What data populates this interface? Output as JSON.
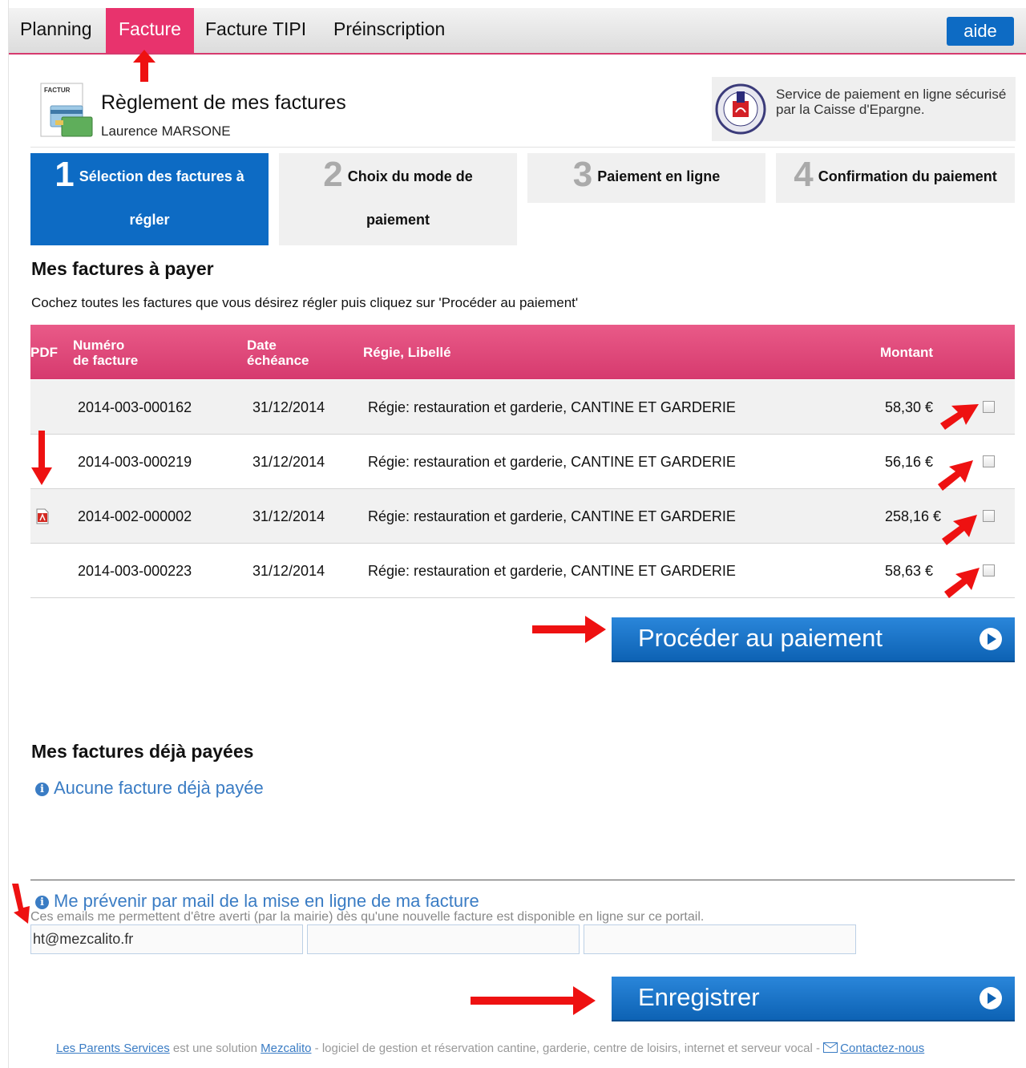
{
  "nav": {
    "tabs": [
      "Planning",
      "Facture",
      "Facture TIPI",
      "Préinscription"
    ],
    "active": "Facture",
    "help_label": "aide"
  },
  "header": {
    "icon_text": "FACTUR",
    "title": "Règlement de mes factures",
    "user": "Laurence MARSONE",
    "secure_text": "Service de paiement en ligne sécurisé par la Caisse d'Epargne."
  },
  "steps": [
    {
      "num": "1",
      "line1": "Sélection des factures à",
      "line2": "régler"
    },
    {
      "num": "2",
      "line1": "Choix du mode de",
      "line2": "paiement"
    },
    {
      "num": "3",
      "line1": "Paiement en ligne",
      "line2": ""
    },
    {
      "num": "4",
      "line1": "Confirmation du paiement",
      "line2": ""
    }
  ],
  "to_pay": {
    "title": "Mes factures à payer",
    "instructions": "Cochez toutes les factures que vous désirez régler puis cliquez sur 'Procéder au paiement'",
    "columns": {
      "pdf": "PDF",
      "number_l1": "Numéro",
      "number_l2": "de facture",
      "date_l1": "Date",
      "date_l2": "échéance",
      "label": "Régie, Libellé",
      "amount": "Montant"
    },
    "rows": [
      {
        "number": "2014-003-000162",
        "date": "31/12/2014",
        "label": "Régie: restauration et garderie, CANTINE ET GARDERIE",
        "amount": "58,30 €",
        "pdf": false
      },
      {
        "number": "2014-003-000219",
        "date": "31/12/2014",
        "label": "Régie: restauration et garderie, CANTINE ET GARDERIE",
        "amount": "56,16 €",
        "pdf": false
      },
      {
        "number": "2014-002-000002",
        "date": "31/12/2014",
        "label": "Régie: restauration et garderie, CANTINE ET GARDERIE",
        "amount": "258,16 €",
        "pdf": true
      },
      {
        "number": "2014-003-000223",
        "date": "31/12/2014",
        "label": "Régie: restauration et garderie, CANTINE ET GARDERIE",
        "amount": "58,63 €",
        "pdf": false
      }
    ],
    "pay_button": "Procéder au paiement"
  },
  "paid": {
    "title": "Mes factures déjà payées",
    "empty": "Aucune facture déjà payée"
  },
  "notify": {
    "title": "Me prévenir par mail de la mise en ligne de ma facture",
    "note": "Ces emails me permettent d'être averti (par la mairie) dès qu'une nouvelle facture est disponible en ligne sur ce portail.",
    "emails": [
      "ht@mezcalito.fr",
      "",
      ""
    ],
    "save_button": "Enregistrer"
  },
  "footer": {
    "link1": "Les Parents Services",
    "text1": " est une solution ",
    "link2": "Mezcalito",
    "text2": " - logiciel de gestion et réservation cantine, garderie, centre de loisirs, internet et serveur vocal - ",
    "contact": "Contactez-nous"
  },
  "colors": {
    "accent_pink": "#e8336d",
    "accent_blue": "#0d6bc4",
    "link_blue": "#3a7cc4",
    "annotation_red": "#ee1111"
  }
}
